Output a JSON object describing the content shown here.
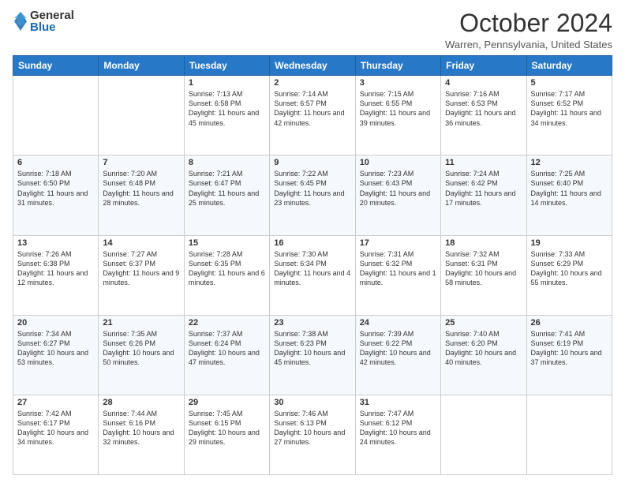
{
  "logo": {
    "general": "General",
    "blue": "Blue"
  },
  "title": "October 2024",
  "location": "Warren, Pennsylvania, United States",
  "days_of_week": [
    "Sunday",
    "Monday",
    "Tuesday",
    "Wednesday",
    "Thursday",
    "Friday",
    "Saturday"
  ],
  "weeks": [
    [
      {
        "day": "",
        "sunrise": "",
        "sunset": "",
        "daylight": ""
      },
      {
        "day": "",
        "sunrise": "",
        "sunset": "",
        "daylight": ""
      },
      {
        "day": "1",
        "sunrise": "Sunrise: 7:13 AM",
        "sunset": "Sunset: 6:58 PM",
        "daylight": "Daylight: 11 hours and 45 minutes."
      },
      {
        "day": "2",
        "sunrise": "Sunrise: 7:14 AM",
        "sunset": "Sunset: 6:57 PM",
        "daylight": "Daylight: 11 hours and 42 minutes."
      },
      {
        "day": "3",
        "sunrise": "Sunrise: 7:15 AM",
        "sunset": "Sunset: 6:55 PM",
        "daylight": "Daylight: 11 hours and 39 minutes."
      },
      {
        "day": "4",
        "sunrise": "Sunrise: 7:16 AM",
        "sunset": "Sunset: 6:53 PM",
        "daylight": "Daylight: 11 hours and 36 minutes."
      },
      {
        "day": "5",
        "sunrise": "Sunrise: 7:17 AM",
        "sunset": "Sunset: 6:52 PM",
        "daylight": "Daylight: 11 hours and 34 minutes."
      }
    ],
    [
      {
        "day": "6",
        "sunrise": "Sunrise: 7:18 AM",
        "sunset": "Sunset: 6:50 PM",
        "daylight": "Daylight: 11 hours and 31 minutes."
      },
      {
        "day": "7",
        "sunrise": "Sunrise: 7:20 AM",
        "sunset": "Sunset: 6:48 PM",
        "daylight": "Daylight: 11 hours and 28 minutes."
      },
      {
        "day": "8",
        "sunrise": "Sunrise: 7:21 AM",
        "sunset": "Sunset: 6:47 PM",
        "daylight": "Daylight: 11 hours and 25 minutes."
      },
      {
        "day": "9",
        "sunrise": "Sunrise: 7:22 AM",
        "sunset": "Sunset: 6:45 PM",
        "daylight": "Daylight: 11 hours and 23 minutes."
      },
      {
        "day": "10",
        "sunrise": "Sunrise: 7:23 AM",
        "sunset": "Sunset: 6:43 PM",
        "daylight": "Daylight: 11 hours and 20 minutes."
      },
      {
        "day": "11",
        "sunrise": "Sunrise: 7:24 AM",
        "sunset": "Sunset: 6:42 PM",
        "daylight": "Daylight: 11 hours and 17 minutes."
      },
      {
        "day": "12",
        "sunrise": "Sunrise: 7:25 AM",
        "sunset": "Sunset: 6:40 PM",
        "daylight": "Daylight: 11 hours and 14 minutes."
      }
    ],
    [
      {
        "day": "13",
        "sunrise": "Sunrise: 7:26 AM",
        "sunset": "Sunset: 6:38 PM",
        "daylight": "Daylight: 11 hours and 12 minutes."
      },
      {
        "day": "14",
        "sunrise": "Sunrise: 7:27 AM",
        "sunset": "Sunset: 6:37 PM",
        "daylight": "Daylight: 11 hours and 9 minutes."
      },
      {
        "day": "15",
        "sunrise": "Sunrise: 7:28 AM",
        "sunset": "Sunset: 6:35 PM",
        "daylight": "Daylight: 11 hours and 6 minutes."
      },
      {
        "day": "16",
        "sunrise": "Sunrise: 7:30 AM",
        "sunset": "Sunset: 6:34 PM",
        "daylight": "Daylight: 11 hours and 4 minutes."
      },
      {
        "day": "17",
        "sunrise": "Sunrise: 7:31 AM",
        "sunset": "Sunset: 6:32 PM",
        "daylight": "Daylight: 11 hours and 1 minute."
      },
      {
        "day": "18",
        "sunrise": "Sunrise: 7:32 AM",
        "sunset": "Sunset: 6:31 PM",
        "daylight": "Daylight: 10 hours and 58 minutes."
      },
      {
        "day": "19",
        "sunrise": "Sunrise: 7:33 AM",
        "sunset": "Sunset: 6:29 PM",
        "daylight": "Daylight: 10 hours and 55 minutes."
      }
    ],
    [
      {
        "day": "20",
        "sunrise": "Sunrise: 7:34 AM",
        "sunset": "Sunset: 6:27 PM",
        "daylight": "Daylight: 10 hours and 53 minutes."
      },
      {
        "day": "21",
        "sunrise": "Sunrise: 7:35 AM",
        "sunset": "Sunset: 6:26 PM",
        "daylight": "Daylight: 10 hours and 50 minutes."
      },
      {
        "day": "22",
        "sunrise": "Sunrise: 7:37 AM",
        "sunset": "Sunset: 6:24 PM",
        "daylight": "Daylight: 10 hours and 47 minutes."
      },
      {
        "day": "23",
        "sunrise": "Sunrise: 7:38 AM",
        "sunset": "Sunset: 6:23 PM",
        "daylight": "Daylight: 10 hours and 45 minutes."
      },
      {
        "day": "24",
        "sunrise": "Sunrise: 7:39 AM",
        "sunset": "Sunset: 6:22 PM",
        "daylight": "Daylight: 10 hours and 42 minutes."
      },
      {
        "day": "25",
        "sunrise": "Sunrise: 7:40 AM",
        "sunset": "Sunset: 6:20 PM",
        "daylight": "Daylight: 10 hours and 40 minutes."
      },
      {
        "day": "26",
        "sunrise": "Sunrise: 7:41 AM",
        "sunset": "Sunset: 6:19 PM",
        "daylight": "Daylight: 10 hours and 37 minutes."
      }
    ],
    [
      {
        "day": "27",
        "sunrise": "Sunrise: 7:42 AM",
        "sunset": "Sunset: 6:17 PM",
        "daylight": "Daylight: 10 hours and 34 minutes."
      },
      {
        "day": "28",
        "sunrise": "Sunrise: 7:44 AM",
        "sunset": "Sunset: 6:16 PM",
        "daylight": "Daylight: 10 hours and 32 minutes."
      },
      {
        "day": "29",
        "sunrise": "Sunrise: 7:45 AM",
        "sunset": "Sunset: 6:15 PM",
        "daylight": "Daylight: 10 hours and 29 minutes."
      },
      {
        "day": "30",
        "sunrise": "Sunrise: 7:46 AM",
        "sunset": "Sunset: 6:13 PM",
        "daylight": "Daylight: 10 hours and 27 minutes."
      },
      {
        "day": "31",
        "sunrise": "Sunrise: 7:47 AM",
        "sunset": "Sunset: 6:12 PM",
        "daylight": "Daylight: 10 hours and 24 minutes."
      },
      {
        "day": "",
        "sunrise": "",
        "sunset": "",
        "daylight": ""
      },
      {
        "day": "",
        "sunrise": "",
        "sunset": "",
        "daylight": ""
      }
    ]
  ]
}
